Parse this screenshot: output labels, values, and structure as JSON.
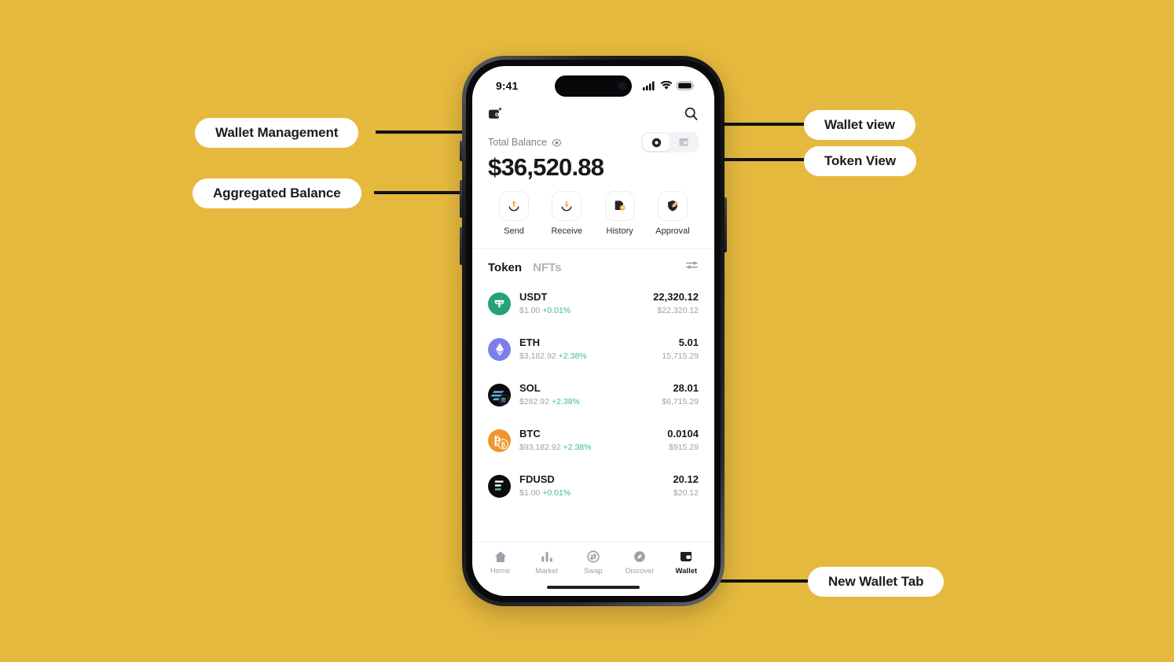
{
  "background_color": "#e5b93e",
  "callouts": [
    {
      "id": "wallet-management",
      "label": "Wallet Management"
    },
    {
      "id": "aggregated-balance",
      "label": "Aggregated Balance"
    },
    {
      "id": "wallet-view",
      "label": "Wallet view"
    },
    {
      "id": "token-view",
      "label": "Token View"
    },
    {
      "id": "new-wallet-tab",
      "label": "New Wallet Tab"
    }
  ],
  "phone": {
    "status_bar": {
      "time": "9:41",
      "icons": [
        "cellular-signal-icon",
        "wifi-icon",
        "battery-icon"
      ]
    },
    "app_header": {
      "wallet_management_icon": "wallet-add-icon",
      "search_icon": "search-icon"
    },
    "balance": {
      "label": "Total Balance",
      "eye_icon": "eye-icon",
      "amount": "$36,520.88",
      "view_toggle": {
        "options": [
          {
            "id": "token-view",
            "icon": "token-coin-icon",
            "active": true
          },
          {
            "id": "wallet-view",
            "icon": "wallet-card-icon",
            "active": false
          }
        ]
      }
    },
    "actions": [
      {
        "label": "Send",
        "icon": "send-arrow-up-icon"
      },
      {
        "label": "Receive",
        "icon": "receive-arrow-down-icon"
      },
      {
        "label": "History",
        "icon": "history-clock-icon"
      },
      {
        "label": "Approval",
        "icon": "approval-edit-icon"
      }
    ],
    "list_header": {
      "tabs": [
        {
          "label": "Token",
          "active": true
        },
        {
          "label": "NFTs",
          "active": false
        }
      ],
      "filter_icon": "filter-sliders-icon"
    },
    "tokens": [
      {
        "symbol": "USDT",
        "price": "$1.00",
        "change": "+0.01%",
        "amount": "22,320.12",
        "value": "$22,320.12",
        "icon": "usdt-icon",
        "icon_color": "#26a17b",
        "glyph": "₮"
      },
      {
        "symbol": "ETH",
        "price": "$3,182.92",
        "change": "+2.38%",
        "amount": "5.01",
        "value": "15,715.29",
        "icon": "eth-icon",
        "icon_color": "#7b7fe8",
        "glyph": "♦"
      },
      {
        "symbol": "SOL",
        "price": "$282.92",
        "change": "+2.38%",
        "amount": "28.01",
        "value": "$6,715.29",
        "icon": "sol-icon",
        "icon_color": "#101014",
        "glyph": ""
      },
      {
        "symbol": "BTC",
        "price": "$93,182.92",
        "change": "+2.38%",
        "amount": "0.0104",
        "value": "$915.29",
        "icon": "btc-icon",
        "icon_color": "#f0962c",
        "glyph": "₿"
      },
      {
        "symbol": "FDUSD",
        "price": "$1.00",
        "change": "+0.01%",
        "amount": "20.12",
        "value": "$20.12",
        "icon": "fdusd-icon",
        "icon_color": "#101014",
        "glyph": "F"
      }
    ],
    "tabbar": [
      {
        "label": "Home",
        "icon": "home-icon",
        "active": false
      },
      {
        "label": "Market",
        "icon": "market-bars-icon",
        "active": false
      },
      {
        "label": "Swap",
        "icon": "swap-circle-icon",
        "active": false
      },
      {
        "label": "Discover",
        "icon": "discover-compass-icon",
        "active": false
      },
      {
        "label": "Wallet",
        "icon": "wallet-icon",
        "active": true
      }
    ]
  },
  "colors": {
    "accent_yellow": "#f2b42b",
    "positive_green": "#3ac07f",
    "dark": "#2c2e34"
  }
}
